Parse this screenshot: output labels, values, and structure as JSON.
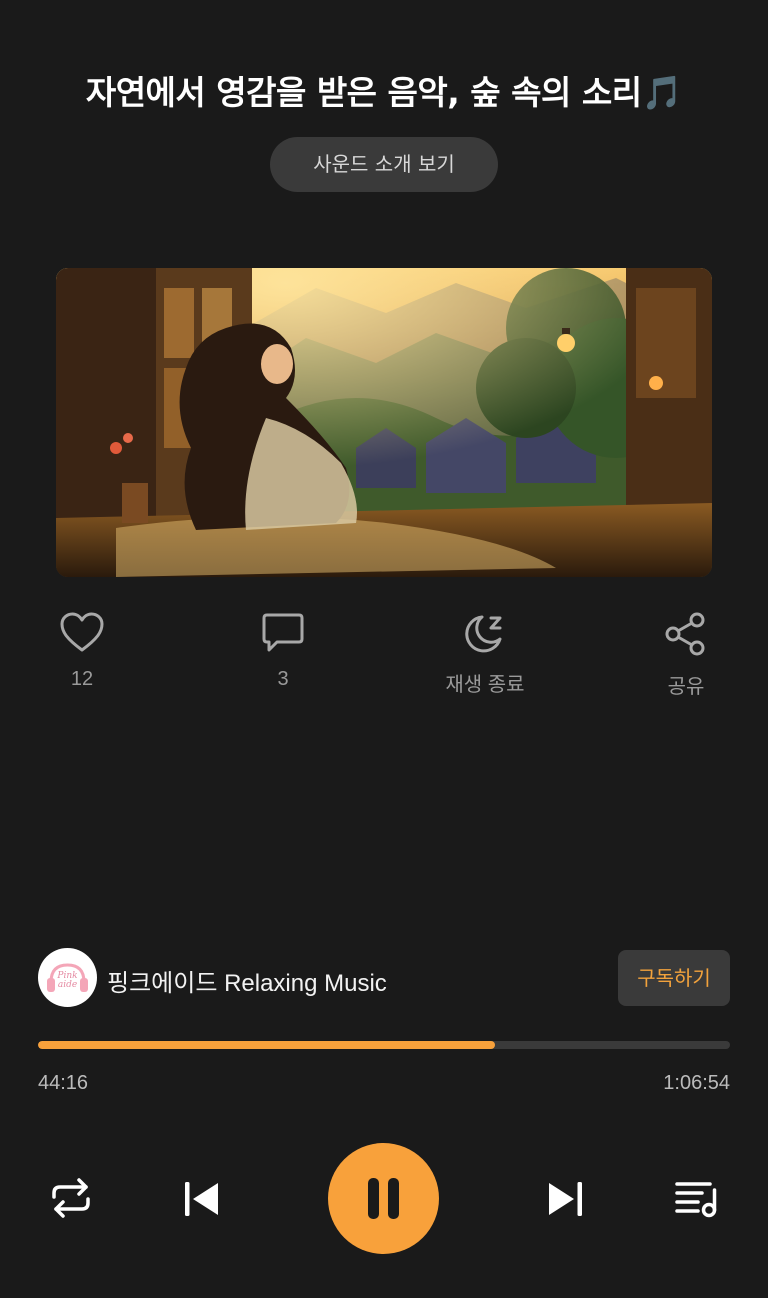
{
  "header": {
    "title": "자연에서 영감을 받은 음악, 숲 속의 소리",
    "title_emoji": "🎵",
    "intro_button_label": "사운드 소개 보기"
  },
  "actions": {
    "like_count": "12",
    "comment_count": "3",
    "sleep_timer_label": "재생 종료",
    "share_label": "공유"
  },
  "channel": {
    "avatar_text": "Pink aide",
    "name": "핑크에이드 Relaxing Music",
    "subscribe_label": "구독하기"
  },
  "player": {
    "current_time": "44:16",
    "total_time": "1:06:54",
    "progress_fraction": 0.661,
    "state": "playing"
  },
  "colors": {
    "accent": "#f8a13b",
    "background": "#1a1a1a",
    "button_bg": "#3a3a3a"
  },
  "icons": {
    "like": "heart-icon",
    "comment": "comment-icon",
    "sleep_timer": "moon-icon",
    "share": "share-icon",
    "repeat": "repeat-icon",
    "previous": "skip-previous-icon",
    "play_pause": "pause-icon",
    "next": "skip-next-icon",
    "playlist": "playlist-icon"
  }
}
